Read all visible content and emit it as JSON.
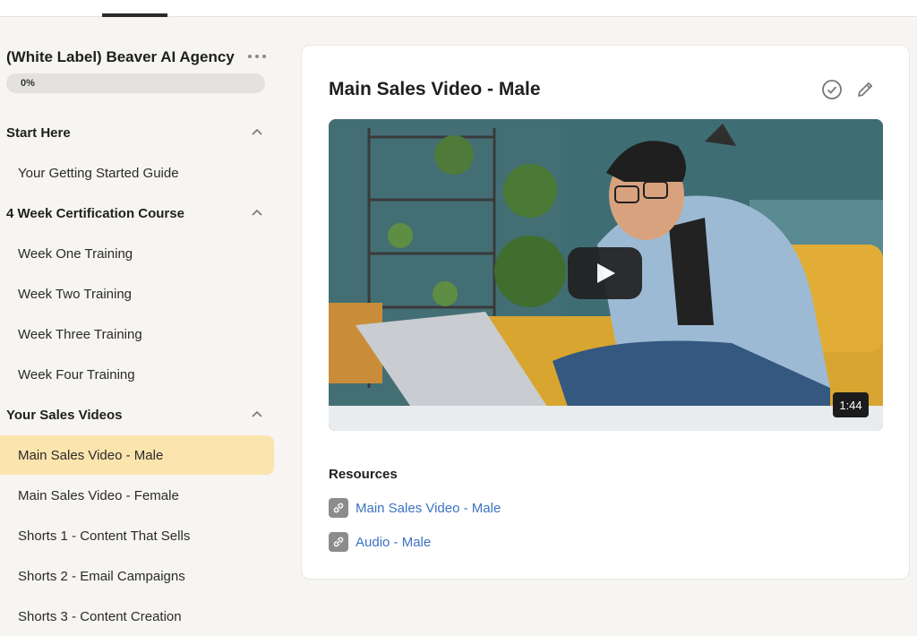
{
  "sidebar": {
    "course_title": "(White Label) Beaver AI Agency ...",
    "progress": {
      "label": "0%",
      "value": 0
    },
    "sections": [
      {
        "label": "Start Here",
        "lessons": [
          "Your Getting Started Guide"
        ]
      },
      {
        "label": "4 Week Certification Course",
        "lessons": [
          "Week One Training",
          "Week Two Training",
          "Week Three Training",
          "Week Four Training"
        ]
      },
      {
        "label": "Your Sales Videos",
        "lessons": [
          "Main Sales Video - Male",
          "Main Sales Video - Female",
          "Shorts 1 - Content That Sells",
          "Shorts 2 - Email Campaigns",
          "Shorts 3 - Content Creation"
        ]
      }
    ],
    "active_lesson": "Main Sales Video - Male"
  },
  "main": {
    "title": "Main Sales Video - Male",
    "video": {
      "duration": "1:44"
    },
    "resources": {
      "title": "Resources",
      "items": [
        "Main Sales Video - Male",
        "Audio - Male"
      ]
    }
  },
  "colors": {
    "active_lesson_bg": "#fbe4ad",
    "link": "#3b73c4"
  },
  "icons": [
    "more-icon",
    "chevron-up-icon",
    "check-circle-icon",
    "pencil-icon",
    "play-icon",
    "link-icon"
  ]
}
